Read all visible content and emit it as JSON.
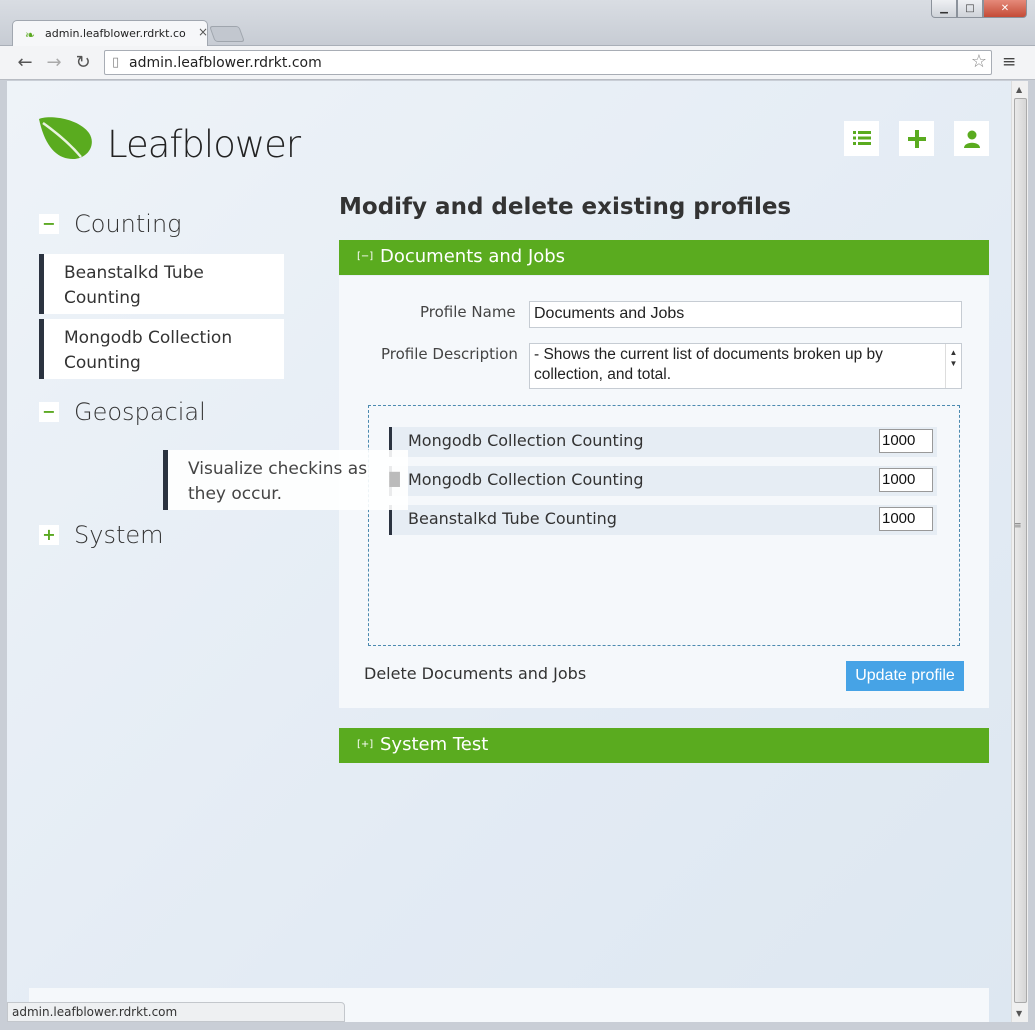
{
  "browser": {
    "tab_title": "admin.leafblower.rdrkt.co",
    "tab_close": "×",
    "url": "admin.leafblower.rdrkt.com",
    "status_url": "admin.leafblower.rdrkt.com",
    "back": "←",
    "forward": "→",
    "reload": "↻",
    "star": "☆",
    "menu": "≡",
    "min": "▁",
    "max": "□",
    "close": "✕"
  },
  "header": {
    "logo_text": "Leafblower"
  },
  "sidebar": {
    "categories": [
      {
        "toggle": "−",
        "label": "Counting"
      },
      {
        "toggle": "−",
        "label": "Geospacial"
      },
      {
        "toggle": "+",
        "label": "System"
      }
    ],
    "counting_items": [
      "Beanstalkd Tube Counting",
      "Mongodb Collection Counting"
    ],
    "dragging_item": "Visualize checkins as they occur."
  },
  "main": {
    "title": "Modify and delete existing profiles",
    "panels": [
      {
        "toggle": "[−]",
        "title": "Documents and Jobs"
      },
      {
        "toggle": "[+]",
        "title": "System Test"
      }
    ],
    "form": {
      "name_label": "Profile Name",
      "name_value": "Documents and Jobs",
      "desc_label": "Profile Description",
      "desc_value": "- Shows the current list of documents broken up by collection, and total.",
      "rows": [
        {
          "label": "Mongodb Collection Counting",
          "value": "1000"
        },
        {
          "label": "Mongodb Collection Counting",
          "value": "1000"
        },
        {
          "label": "Beanstalkd Tube Counting",
          "value": "1000"
        }
      ],
      "delete_label": "Delete Documents and Jobs",
      "update_label": "Update profile"
    }
  },
  "colors": {
    "accent_green": "#5aab1f",
    "button_blue": "#46a3e6",
    "dark_border": "#2b3340"
  }
}
